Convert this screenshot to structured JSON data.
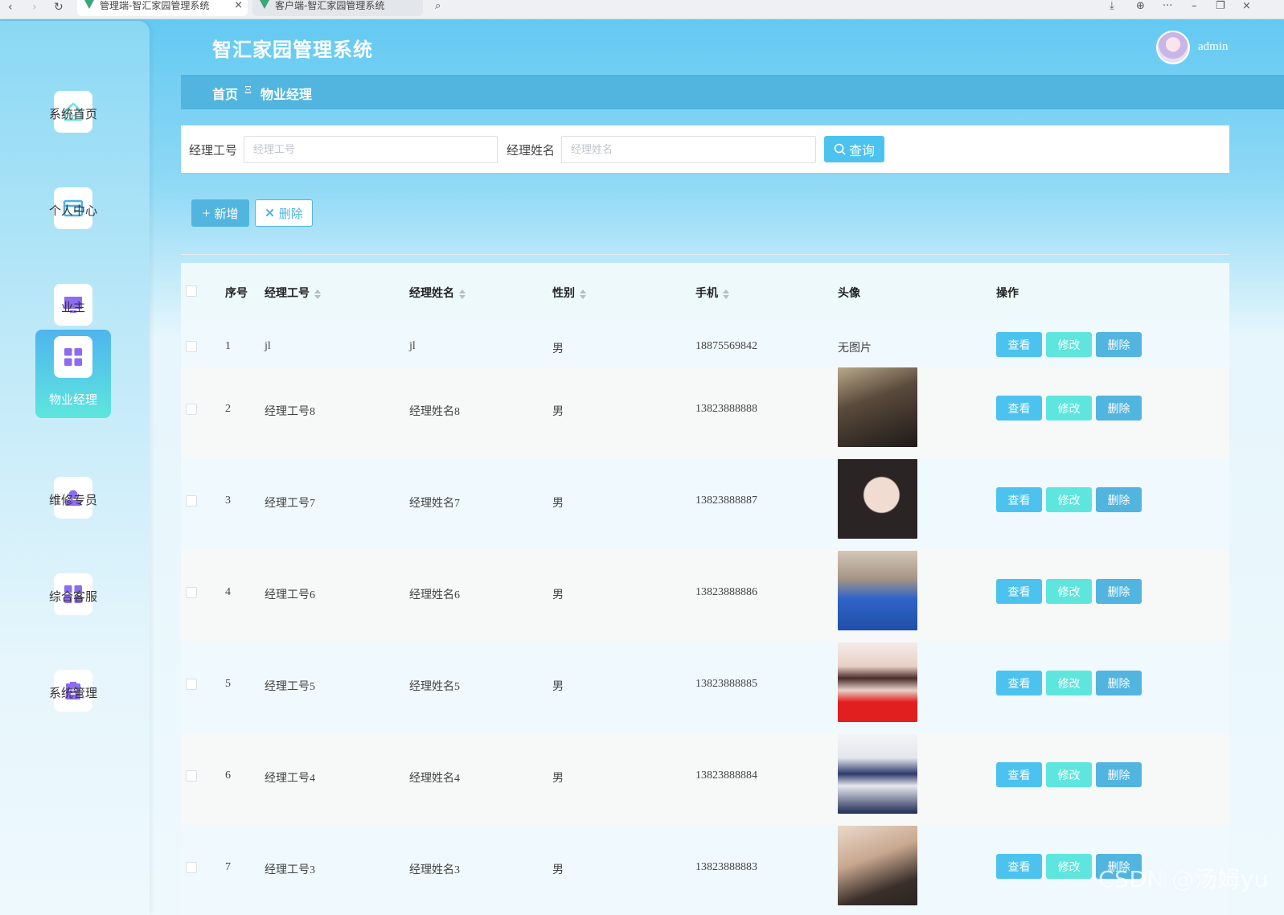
{
  "browser": {
    "back": "‹",
    "forward": "›",
    "reload": "↻",
    "tabs": [
      {
        "label": "管理端-智汇家园管理系统",
        "close": "×"
      },
      {
        "label": "客户端-智汇家园管理系统"
      }
    ],
    "search_icon": "⌕",
    "menu_dots": "···",
    "minimize": "–",
    "restore": "❐",
    "close": "×"
  },
  "header": {
    "title": "智汇家园管理系统",
    "user": "admin"
  },
  "breadcrumb": {
    "home": "首页",
    "separator": "Ξ",
    "current": "物业经理"
  },
  "sidebar": {
    "items": [
      {
        "label": "系统首页",
        "icon": "home-icon"
      },
      {
        "label": "个人中心",
        "icon": "card-icon"
      },
      {
        "label": "业主",
        "icon": "monitor-icon"
      },
      {
        "label": "物业经理",
        "icon": "grid-icon",
        "active": true
      },
      {
        "label": "维修专员",
        "icon": "person-icon"
      },
      {
        "label": "综合客服",
        "icon": "grid-icon"
      },
      {
        "label": "系统管理",
        "icon": "clipboard-icon"
      }
    ]
  },
  "search": {
    "field1_label": "经理工号",
    "field1_placeholder": "经理工号",
    "field2_label": "经理姓名",
    "field2_placeholder": "经理姓名",
    "query_label": "查询"
  },
  "actions": {
    "add_label": "新增",
    "delete_label": "删除"
  },
  "table": {
    "columns": [
      "序号",
      "经理工号",
      "经理姓名",
      "性别",
      "手机",
      "头像",
      "操作"
    ],
    "row_actions": {
      "view": "查看",
      "edit": "修改",
      "delete": "删除"
    },
    "rows": [
      {
        "index": "1",
        "id": "jl",
        "name": "jl",
        "gender": "男",
        "phone": "18875569842",
        "avatar": "无图片"
      },
      {
        "index": "2",
        "id": "经理工号8",
        "name": "经理姓名8",
        "gender": "男",
        "phone": "13823888888",
        "avatar": ""
      },
      {
        "index": "3",
        "id": "经理工号7",
        "name": "经理姓名7",
        "gender": "男",
        "phone": "13823888887",
        "avatar": ""
      },
      {
        "index": "4",
        "id": "经理工号6",
        "name": "经理姓名6",
        "gender": "男",
        "phone": "13823888886",
        "avatar": ""
      },
      {
        "index": "5",
        "id": "经理工号5",
        "name": "经理姓名5",
        "gender": "男",
        "phone": "13823888885",
        "avatar": ""
      },
      {
        "index": "6",
        "id": "经理工号4",
        "name": "经理姓名4",
        "gender": "男",
        "phone": "13823888884",
        "avatar": ""
      },
      {
        "index": "7",
        "id": "经理工号3",
        "name": "经理姓名3",
        "gender": "男",
        "phone": "13823888883",
        "avatar": ""
      }
    ]
  },
  "colors": {
    "primary": "#52b5df",
    "view": "#4bc3ee",
    "edit": "#5ee6de",
    "header": "#5ec7f2"
  },
  "watermark": "CSDN @汤姆yu"
}
